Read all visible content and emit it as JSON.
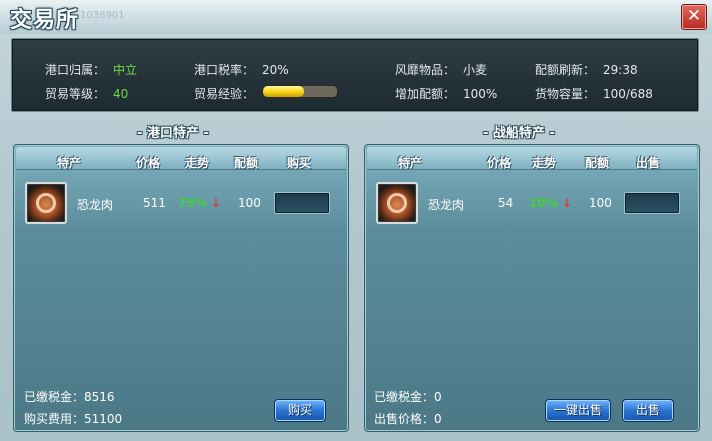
{
  "window": {
    "title": "交易所",
    "watermark": "1038901",
    "close_label": "✕"
  },
  "info": {
    "port_owner_label": "港口归属：",
    "port_owner_value": "中立",
    "tax_rate_label": "港口税率：",
    "tax_rate_value": "20%",
    "popular_goods_label": "风靡物品：",
    "popular_goods_value": "小麦",
    "quota_refresh_label": "配额刷新：",
    "quota_refresh_value": "29:38",
    "trade_level_label": "贸易等级：",
    "trade_level_value": "40",
    "trade_exp_label": "贸易经验：",
    "trade_exp_progress": 0.55,
    "extra_quota_label": "增加配额：",
    "extra_quota_value": "100%",
    "cargo_capacity_label": "货物容量：",
    "cargo_capacity_value": "100/688"
  },
  "port_panel": {
    "title": "- 港口特产 -",
    "headers": {
      "item": "特产",
      "price": "价格",
      "trend": "走势",
      "quota": "配额",
      "action": "购买"
    },
    "rows": [
      {
        "name": "恐龙肉",
        "price": "511",
        "trend": "79%",
        "trend_arrow": "↓",
        "quota": "100",
        "icon": "dinosaur-meat-icon"
      }
    ],
    "tax_paid_label": "已缴税金：",
    "tax_paid_value": "8516",
    "cost_label": "购买费用：",
    "cost_value": "51100",
    "buy_button": "购买"
  },
  "ship_panel": {
    "title": "- 战船特产 -",
    "headers": {
      "item": "特产",
      "price": "价格",
      "trend": "走势",
      "quota": "配额",
      "action": "出售"
    },
    "rows": [
      {
        "name": "恐龙肉",
        "price": "54",
        "trend": "10%",
        "trend_arrow": "↓",
        "quota": "100",
        "icon": "dinosaur-meat-icon"
      }
    ],
    "tax_paid_label": "已缴税金：",
    "tax_paid_value": "0",
    "sell_price_label": "出售价格：",
    "sell_price_value": "0",
    "sell_all_button": "一键出售",
    "sell_button": "出售"
  },
  "colors": {
    "positive": "#6fdc3e",
    "down_arrow": "#e53a2a",
    "button": "#2c74d0"
  }
}
